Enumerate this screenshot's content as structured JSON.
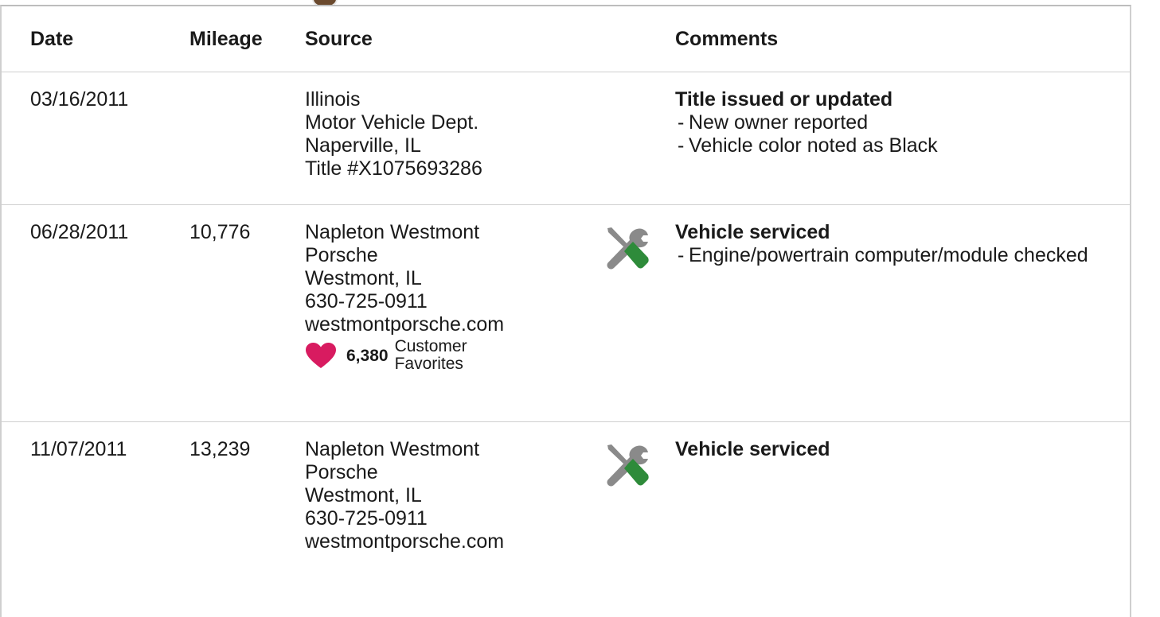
{
  "table": {
    "headers": {
      "date": "Date",
      "mileage": "Mileage",
      "source": "Source",
      "comments": "Comments"
    },
    "rows": [
      {
        "date": "03/16/2011",
        "mileage": "",
        "source": [
          "Illinois",
          "Motor Vehicle Dept.",
          "Naperville, IL",
          "Title #X1075693286"
        ],
        "icon": "",
        "comment_title": "Title issued or updated",
        "comment_items": [
          "New owner reported",
          "Vehicle color noted as Black"
        ]
      },
      {
        "date": "06/28/2011",
        "mileage": "10,776",
        "source": [
          "Napleton Westmont",
          "Porsche",
          "Westmont, IL",
          "630-725-0911",
          "westmontporsche.com"
        ],
        "favorites": {
          "count": "6,380",
          "label_line1": "Customer",
          "label_line2": "Favorites"
        },
        "icon": "service-tools-icon",
        "comment_title": "Vehicle serviced",
        "comment_items": [
          "Engine/powertrain computer/module checked"
        ]
      },
      {
        "date": "11/07/2011",
        "mileage": "13,239",
        "source": [
          "Napleton Westmont",
          "Porsche",
          "Westmont, IL",
          "630-725-0911",
          "westmontporsche.com"
        ],
        "icon": "service-tools-icon",
        "comment_title": "Vehicle serviced",
        "comment_items": []
      }
    ]
  },
  "colors": {
    "heart": "#d81b60",
    "wrench": "#8a8a8a",
    "screwdriver_handle": "#2e8b3a",
    "border": "#cfcfcf"
  }
}
